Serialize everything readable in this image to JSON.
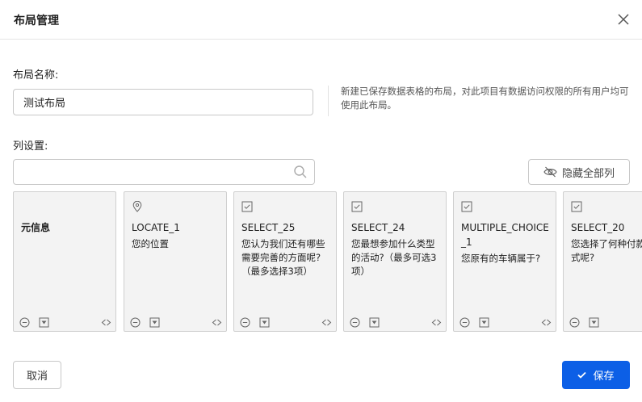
{
  "dialog": {
    "title": "布局管理",
    "close_icon": "close-icon"
  },
  "form": {
    "name_label": "布局名称:",
    "name_value": "测试布局",
    "hint": "新建已保存数据表格的布局，对此项目有数据访问权限的所有用户均可使用此布局。",
    "columns_label": "列设置:",
    "search_value": "",
    "hide_all_label": "隐藏全部列"
  },
  "cards": [
    {
      "field": "元信息",
      "question": "",
      "icon": "none"
    },
    {
      "field": "LOCATE_1",
      "question": "您的位置",
      "icon": "location-pin-icon"
    },
    {
      "field": "SELECT_25",
      "question": "您认为我们还有哪些需要完善的方面呢?（最多选择3项）",
      "icon": "checkbox-icon"
    },
    {
      "field": "SELECT_24",
      "question": "您最想参加什么类型的活动?（最多可选3项）",
      "icon": "checkbox-icon"
    },
    {
      "field": "MULTIPLE_CHOICE_1",
      "question": "您原有的车辆属于?",
      "icon": "checkbox-icon"
    },
    {
      "field": "SELECT_20",
      "question": "您选择了何种付款方式呢?",
      "icon": "checkbox-icon"
    }
  ],
  "footer": {
    "cancel_label": "取消",
    "save_label": "保存"
  },
  "colors": {
    "primary": "#0c5fe6",
    "card_bg": "#f3f3f3",
    "border": "#c8c8c8"
  }
}
